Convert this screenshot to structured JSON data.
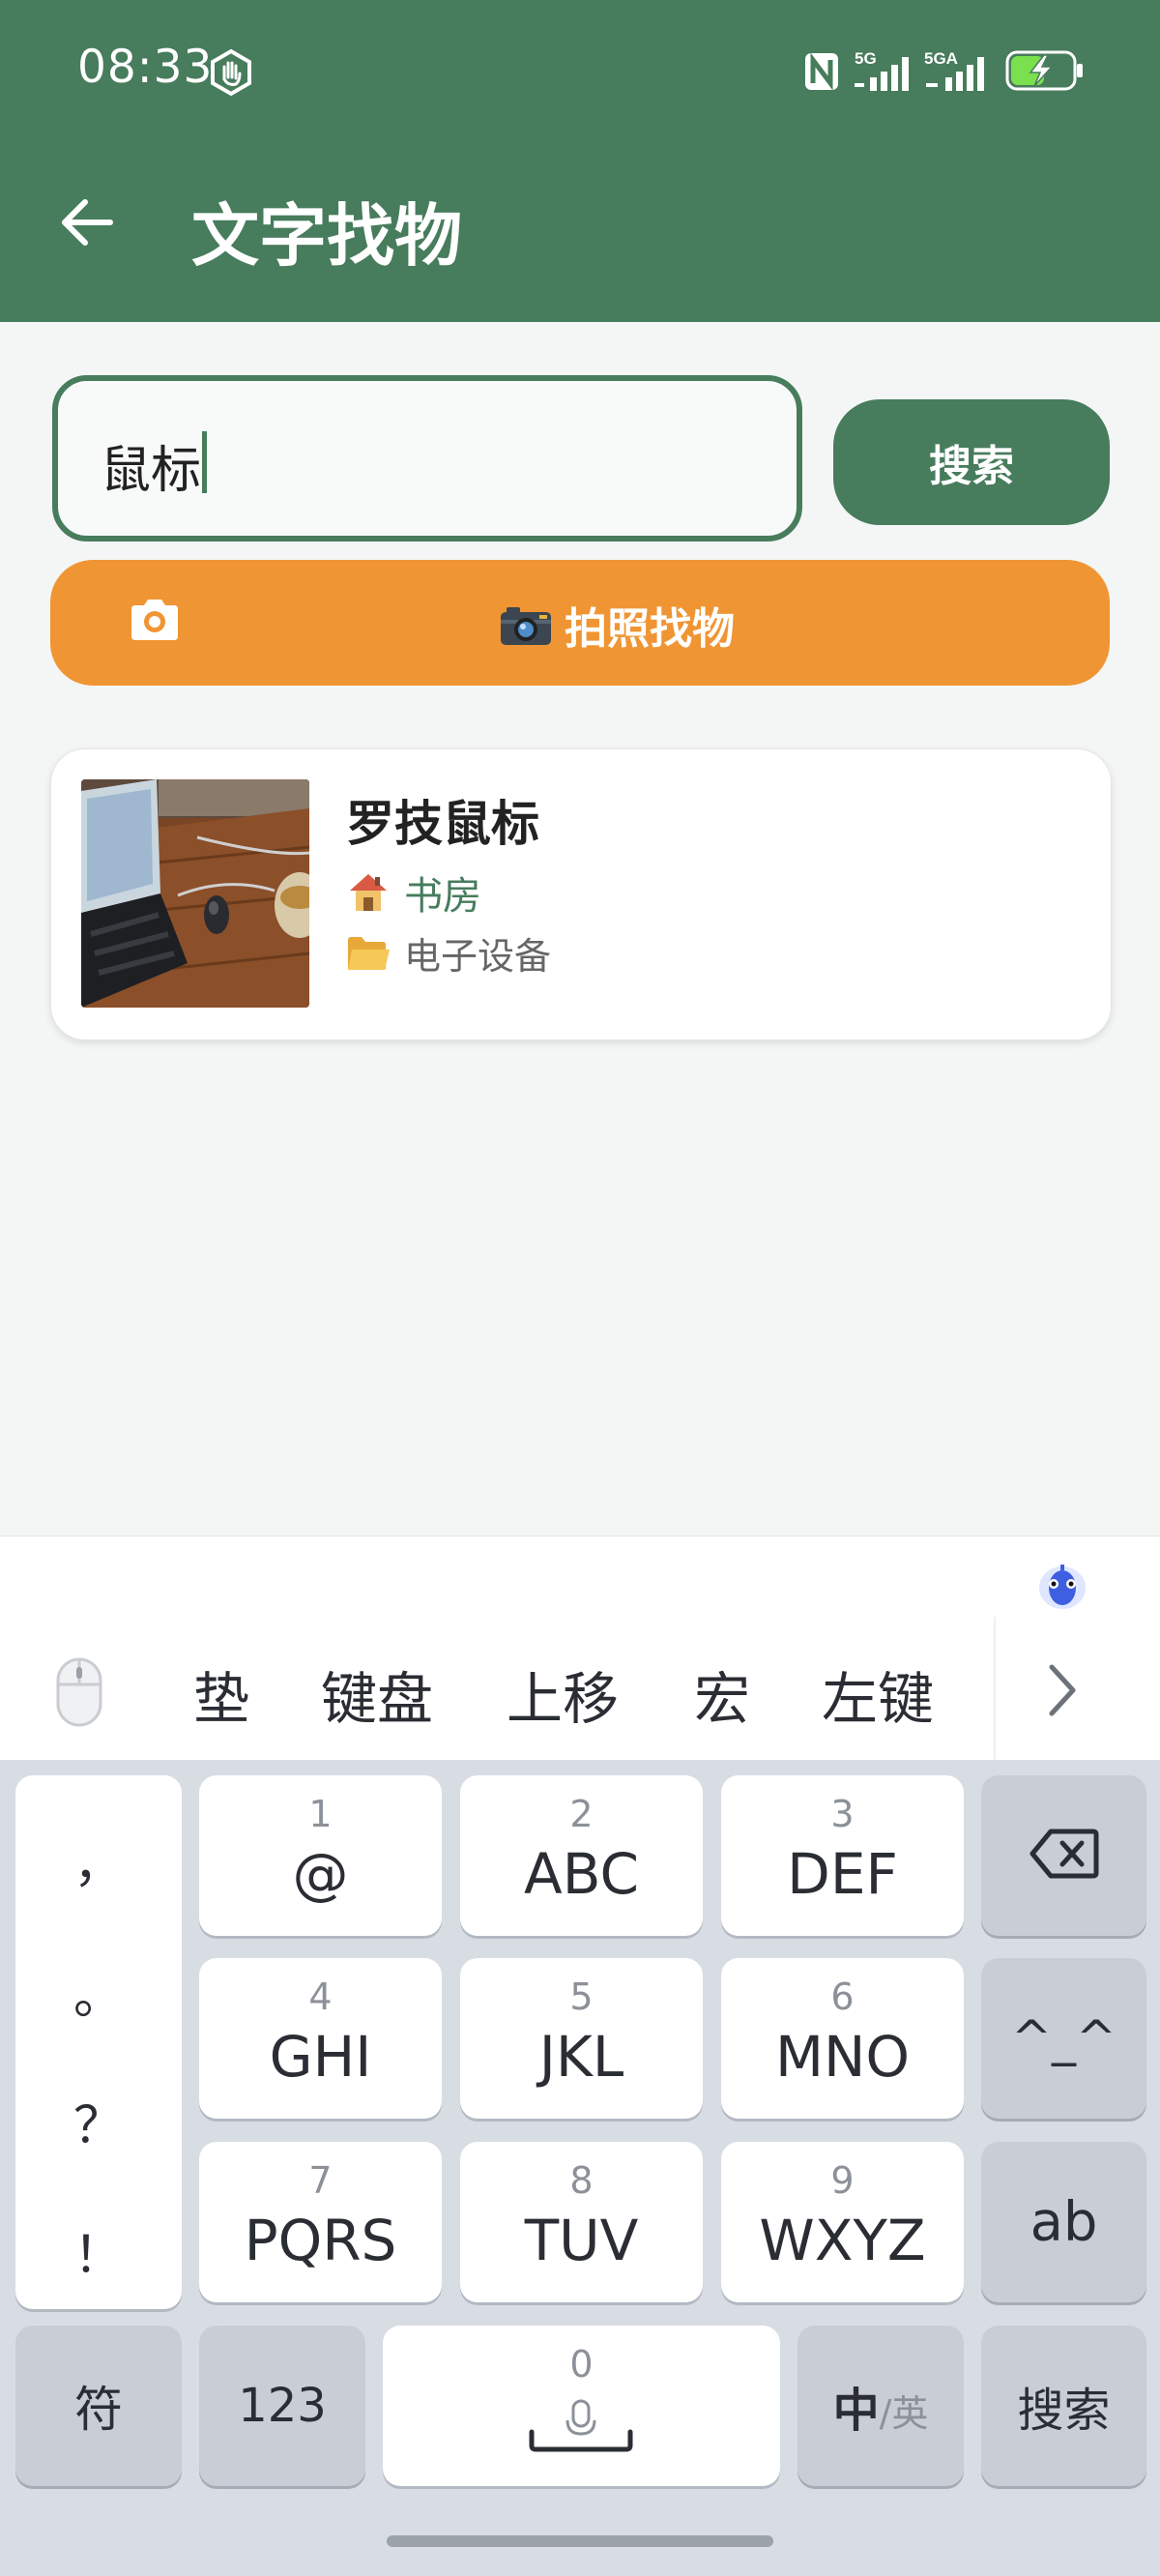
{
  "status_bar": {
    "time": "08:33",
    "network1": "5G",
    "network2": "5GA",
    "icons": [
      "hand-icon",
      "nfc-icon",
      "signal-icon",
      "signal-icon",
      "battery-charging-icon"
    ]
  },
  "app_bar": {
    "title": "文字找物",
    "back_icon": "arrow-left-icon"
  },
  "search": {
    "value": "鼠标",
    "button_label": "搜索",
    "photo_button_label": "📷 拍照找物",
    "photo_button_text": "拍照找物"
  },
  "results": [
    {
      "name": "罗技鼠标",
      "room": "书房",
      "category": "电子设备",
      "room_icon": "house-icon",
      "category_icon": "folder-icon"
    }
  ],
  "keyboard": {
    "candidates": [
      "垫",
      "键盘",
      "上移",
      "宏",
      "左键"
    ],
    "punctuation": [
      "，",
      "。",
      "？",
      "！"
    ],
    "keys": [
      {
        "num": "1",
        "label": "@"
      },
      {
        "num": "2",
        "label": "ABC"
      },
      {
        "num": "3",
        "label": "DEF"
      },
      {
        "num": "4",
        "label": "GHI"
      },
      {
        "num": "5",
        "label": "JKL"
      },
      {
        "num": "6",
        "label": "MNO"
      },
      {
        "num": "7",
        "label": "PQRS"
      },
      {
        "num": "8",
        "label": "TUV"
      },
      {
        "num": "9",
        "label": "WXYZ"
      }
    ],
    "emoticon": "^_^",
    "ab": "ab",
    "symbols": "符",
    "numbers": "123",
    "zero": "0",
    "lang_main": "中",
    "lang_alt": "/英",
    "search": "搜索"
  },
  "colors": {
    "primary": "#477c5c",
    "accent": "#f09533",
    "background": "#f4f6f5"
  }
}
